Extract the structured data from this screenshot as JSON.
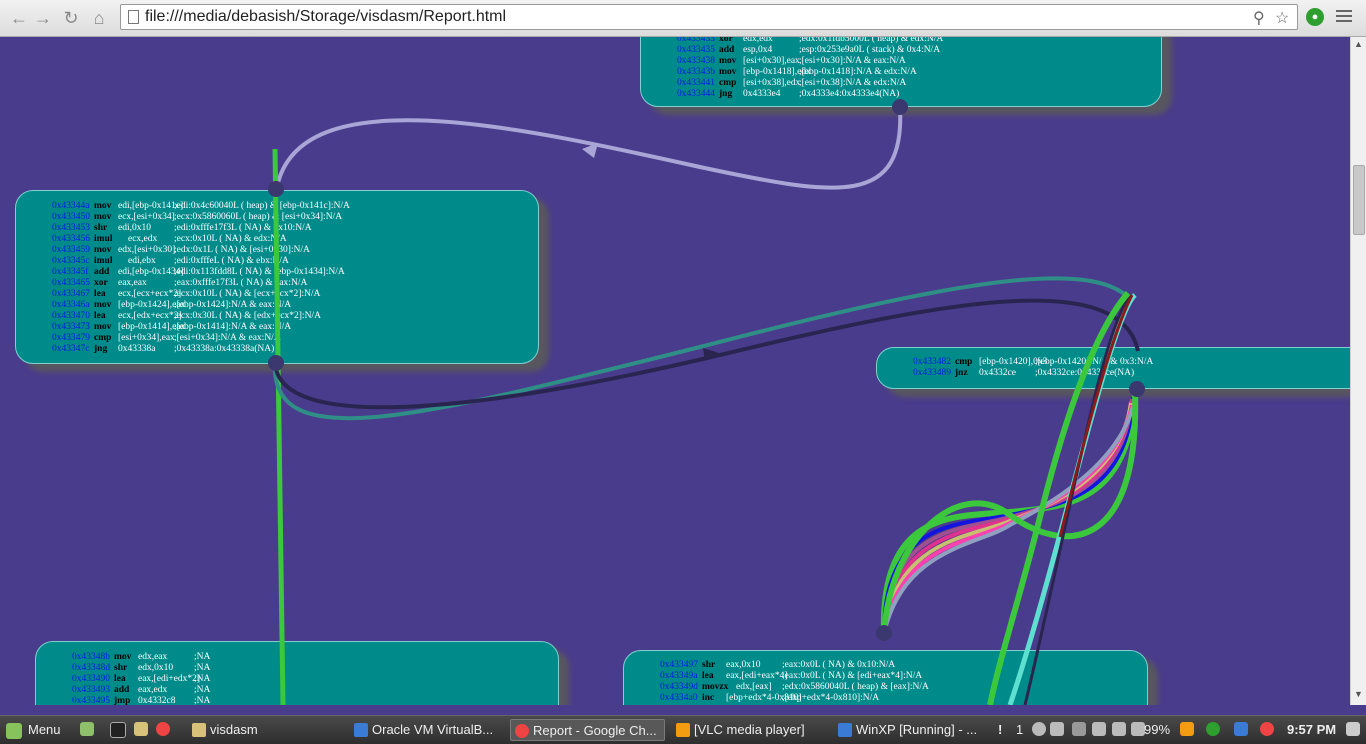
{
  "browser": {
    "url": "file:///media/debasish/Storage/visdasm/Report.html"
  },
  "blocks": [
    {
      "id": "block-0x433433",
      "rows": [
        {
          "addr": "0x433433",
          "mn": "xor",
          "ops": "edx,edx",
          "cm": ";edx:0x1fdb5000L ( heap) & edx:N/A"
        },
        {
          "addr": "0x433435",
          "mn": "add",
          "ops": "esp,0x4",
          "cm": ";esp:0x253e9a0L ( stack) & 0x4:N/A"
        },
        {
          "addr": "0x433438",
          "mn": "mov",
          "ops": "[esi+0x30],eax",
          "cm": ";[esi+0x30]:N/A & eax:N/A"
        },
        {
          "addr": "0x43343b",
          "mn": "mov",
          "ops": "[ebp-0x1418],edx",
          "cm": ";[ebp-0x1418]:N/A & edx:N/A"
        },
        {
          "addr": "0x433441",
          "mn": "cmp",
          "ops": "[esi+0x38],edx",
          "cm": ";[esi+0x38]:N/A & edx:N/A"
        },
        {
          "addr": "0x433444",
          "mn": "jng",
          "ops": "0x4333e4",
          "cm": ";0x4333e4:0x4333e4(NA)"
        }
      ]
    },
    {
      "id": "block-0x43344a",
      "rows": [
        {
          "addr": "0x43344a",
          "mn": "mov",
          "ops": "edi,[ebp-0x141c]",
          "cm": ";edi:0x4c60040L ( heap) & [ebp-0x141c]:N/A"
        },
        {
          "addr": "0x433450",
          "mn": "mov",
          "ops": "ecx,[esi+0x34]",
          "cm": ";ecx:0x5860060L ( heap) & [esi+0x34]:N/A"
        },
        {
          "addr": "0x433453",
          "mn": "shr",
          "ops": "edi,0x10",
          "cm": ";edi:0xfffe17f3L ( NA) & 0x10:N/A"
        },
        {
          "addr": "0x433456",
          "mn": "imul",
          "ops": "ecx,edx",
          "cm": ";ecx:0x10L ( NA) & edx:N/A"
        },
        {
          "addr": "0x433459",
          "mn": "mov",
          "ops": "edx,[esi+0x30]",
          "cm": ";edx:0x1L ( NA) & [esi+0x30]:N/A"
        },
        {
          "addr": "0x43345c",
          "mn": "imul",
          "ops": "edi,ebx",
          "cm": ";edi:0xfffeL ( NA) & ebx:N/A"
        },
        {
          "addr": "0x43345f",
          "mn": "add",
          "ops": "edi,[ebp-0x1434]",
          "cm": ";edi:0x113fdd8L ( NA) & [ebp-0x1434]:N/A"
        },
        {
          "addr": "0x433465",
          "mn": "xor",
          "ops": "eax,eax",
          "cm": ";eax:0xfffe17f3L ( NA) & eax:N/A"
        },
        {
          "addr": "0x433467",
          "mn": "lea",
          "ops": "ecx,[ecx+ecx*2]",
          "cm": ";ecx:0x10L ( NA) & [ecx+ecx*2]:N/A"
        },
        {
          "addr": "0x43346a",
          "mn": "mov",
          "ops": "[ebp-0x1424],eax",
          "cm": ";[ebp-0x1424]:N/A & eax:N/A"
        },
        {
          "addr": "0x433470",
          "mn": "lea",
          "ops": "ecx,[edx+ecx*2]",
          "cm": ";ecx:0x30L ( NA) & [edx+ecx*2]:N/A"
        },
        {
          "addr": "0x433473",
          "mn": "mov",
          "ops": "[ebp-0x1414],eax",
          "cm": ";[ebp-0x1414]:N/A & eax:N/A"
        },
        {
          "addr": "0x433479",
          "mn": "cmp",
          "ops": "[esi+0x34],eax",
          "cm": ";[esi+0x34]:N/A & eax:N/A"
        },
        {
          "addr": "0x43347c",
          "mn": "jng",
          "ops": "0x43338a",
          "cm": ";0x43338a:0x43338a(NA)"
        }
      ]
    },
    {
      "id": "block-0x433482",
      "rows": [
        {
          "addr": "0x433482",
          "mn": "cmp",
          "ops": "[ebp-0x1420],0x3",
          "cm": ";[ebp-0x1420]:N/A & 0x3:N/A"
        },
        {
          "addr": "0x433489",
          "mn": "jnz",
          "ops": "0x4332ce",
          "cm": ";0x4332ce:0x4332ce(NA)"
        }
      ]
    },
    {
      "id": "block-0x43348b",
      "rows": [
        {
          "addr": "0x43348b",
          "mn": "mov",
          "ops": "edx,eax",
          "cm": ";NA"
        },
        {
          "addr": "0x43348d",
          "mn": "shr",
          "ops": "edx,0x10",
          "cm": ";NA"
        },
        {
          "addr": "0x433490",
          "mn": "lea",
          "ops": "eax,[edi+edx*2]",
          "cm": ";NA"
        },
        {
          "addr": "0x433493",
          "mn": "add",
          "ops": "eax,edx",
          "cm": ";NA"
        },
        {
          "addr": "0x433495",
          "mn": "jmp",
          "ops": "0x4332c8",
          "cm": ";NA"
        }
      ]
    },
    {
      "id": "block-0x433497",
      "rows": [
        {
          "addr": "0x433497",
          "mn": "shr",
          "ops": "eax,0x10",
          "cm": ";eax:0x0L ( NA) & 0x10:N/A"
        },
        {
          "addr": "0x43349a",
          "mn": "lea",
          "ops": "eax,[edi+eax*4]",
          "cm": ";eax:0x0L ( NA) & [edi+eax*4]:N/A"
        },
        {
          "addr": "0x43349d",
          "mn": "movzx",
          "ops": "edx,[eax]",
          "cm": ";edx:0x5860040L ( heap) & [eax]:N/A"
        },
        {
          "addr": "0x4334a0",
          "mn": "inc",
          "ops": "[ebp+edx*4-0x810]",
          "cm": ";[ebp+edx*4-0x810]:N/A"
        }
      ]
    }
  ],
  "taskbar": {
    "menu_label": "Menu",
    "tasks": [
      {
        "label": "visdasm"
      },
      {
        "label": "Oracle VM VirtualB..."
      },
      {
        "label": "Report - Google Ch..."
      },
      {
        "label": "[VLC media player]"
      },
      {
        "label": "WinXP [Running] - ..."
      }
    ],
    "workspace": "1",
    "battery": "99%",
    "clock": "9:57 PM"
  },
  "colors": {
    "canvas": "#4a3c8c",
    "block_fill": "#008b8b",
    "address": "#0018e8",
    "edge_green": "#3cc83c",
    "edge_lavender": "#a9a5d6",
    "edge_dark": "#2a2550",
    "edge_teal": "#2f8f86"
  }
}
